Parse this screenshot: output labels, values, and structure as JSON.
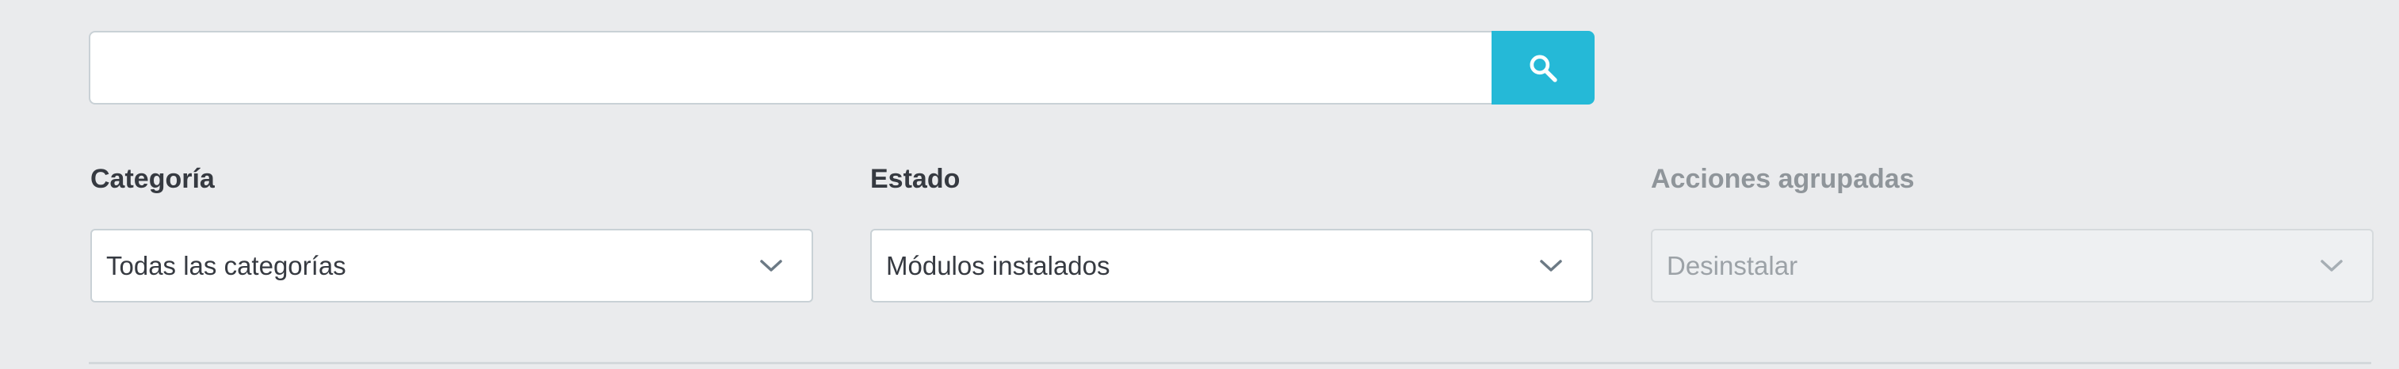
{
  "search": {
    "value": "",
    "placeholder": "",
    "button_icon": "search-icon",
    "button_color": "#25b9d7"
  },
  "filters": {
    "category": {
      "label": "Categoría",
      "selected": "Todas las categorías",
      "icon": "chevron-down-icon"
    },
    "status": {
      "label": "Estado",
      "selected": "Módulos instalados",
      "icon": "chevron-down-icon"
    },
    "bulk_actions": {
      "label": "Acciones agrupadas",
      "selected": "Desinstalar",
      "icon": "chevron-down-icon",
      "disabled": true
    }
  }
}
